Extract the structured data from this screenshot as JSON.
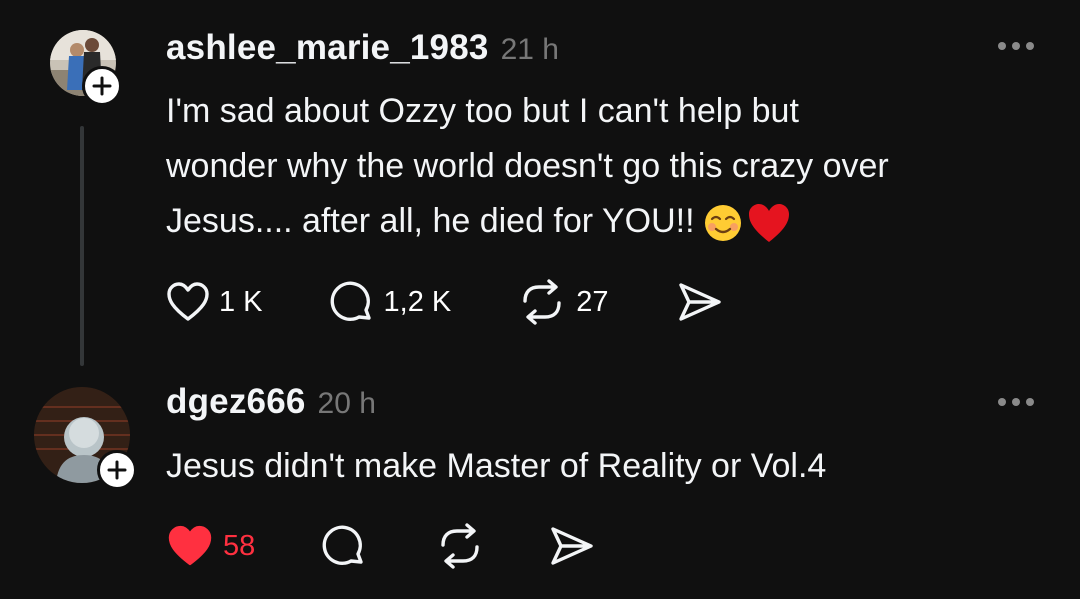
{
  "posts": [
    {
      "username": "ashlee_marie_1983",
      "time": "21 h",
      "text": "I'm sad about Ozzy too but I can't help but\nwonder why the world doesn't go this crazy over\nJesus.... after all, he died for YOU!!",
      "emojis": [
        "smiling-face-icon",
        "red-heart-icon"
      ],
      "counts": {
        "likes": "1 K",
        "replies": "1,2 K",
        "reposts": "27"
      },
      "liked": false
    },
    {
      "username": "dgez666",
      "time": "20 h",
      "text": "Jesus didn't make Master of Reality or Vol.4",
      "counts": {
        "likes": "58"
      },
      "liked": true
    }
  ],
  "colors": {
    "background": "#101010",
    "text": "#f3f5f7",
    "secondary": "#777777",
    "like_active": "#ff3040",
    "thread_line": "#333638"
  }
}
